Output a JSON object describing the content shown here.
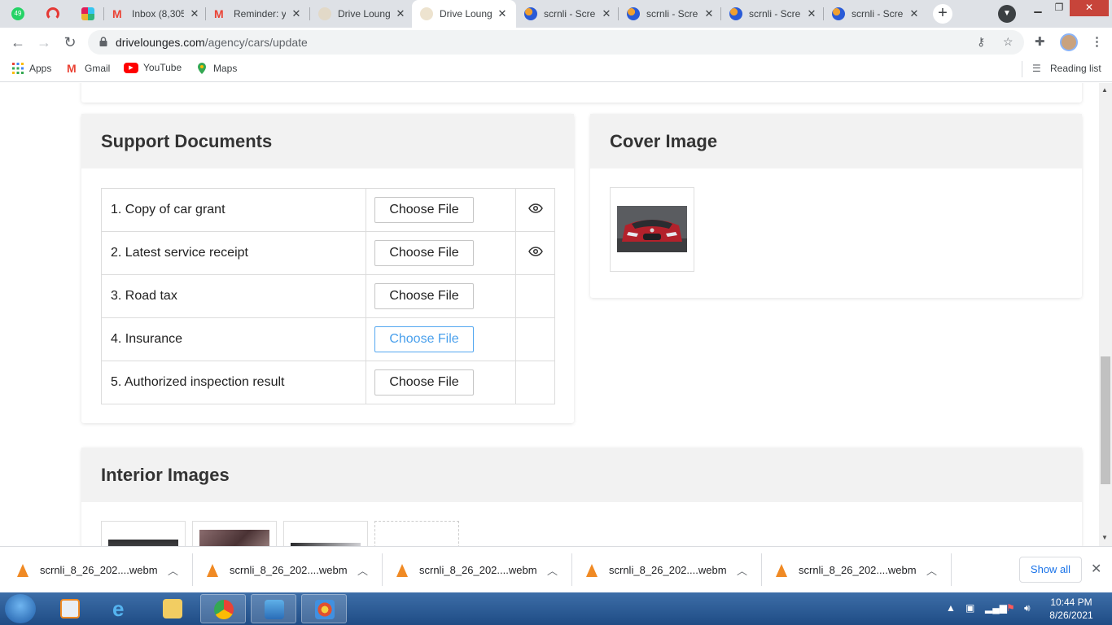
{
  "browser": {
    "tabs": [
      {
        "title": "",
        "pinned": true,
        "favicon_color": "#25d366"
      },
      {
        "title": "",
        "pinned": true,
        "favicon_color": "#e53935"
      },
      {
        "title": "",
        "pinned": true,
        "favicon_color": "#e01e5a"
      },
      {
        "title": "Inbox (8,305",
        "favicon_color": "#ea4335"
      },
      {
        "title": "Reminder: y",
        "favicon_color": "#ea4335"
      },
      {
        "title": "Drive Loung",
        "favicon_color": "#d8cfc0"
      },
      {
        "title": "Drive Loung",
        "active": true,
        "favicon_color": "#e8dcc2"
      },
      {
        "title": "scrnli - Scre",
        "favicon_color": "#2a5bd7"
      },
      {
        "title": "scrnli - Scre",
        "favicon_color": "#2a5bd7"
      },
      {
        "title": "scrnli - Scre",
        "favicon_color": "#2a5bd7"
      },
      {
        "title": "scrnli - Scre",
        "favicon_color": "#2a5bd7"
      }
    ],
    "whatsapp_badge": "49",
    "url_host": "drivelounges.com",
    "url_path": "/agency/cars/update",
    "bookmarks": {
      "apps": "Apps",
      "gmail": "Gmail",
      "youtube": "YouTube",
      "maps": "Maps",
      "reading_list": "Reading list"
    }
  },
  "support_documents": {
    "title": "Support Documents",
    "button_label": "Choose File",
    "rows": [
      {
        "label": "1. Copy of car grant",
        "has_view": true
      },
      {
        "label": "2. Latest service receipt",
        "has_view": true
      },
      {
        "label": "3. Road tax",
        "has_view": false
      },
      {
        "label": "4. Insurance",
        "has_view": false,
        "focused": true
      },
      {
        "label": "5. Authorized inspection result",
        "has_view": false
      }
    ]
  },
  "cover_image": {
    "title": "Cover Image"
  },
  "interior_images": {
    "title": "Interior Images"
  },
  "downloads": {
    "items": [
      "scrnli_8_26_202....webm",
      "scrnli_8_26_202....webm",
      "scrnli_8_26_202....webm",
      "scrnli_8_26_202....webm",
      "scrnli_8_26_202....webm"
    ],
    "show_all": "Show all"
  },
  "taskbar": {
    "time": "10:44 PM",
    "date": "8/26/2021"
  },
  "colors": {
    "accent_blue": "#4aa0ec",
    "card_header_bg": "#f2f2f2"
  }
}
